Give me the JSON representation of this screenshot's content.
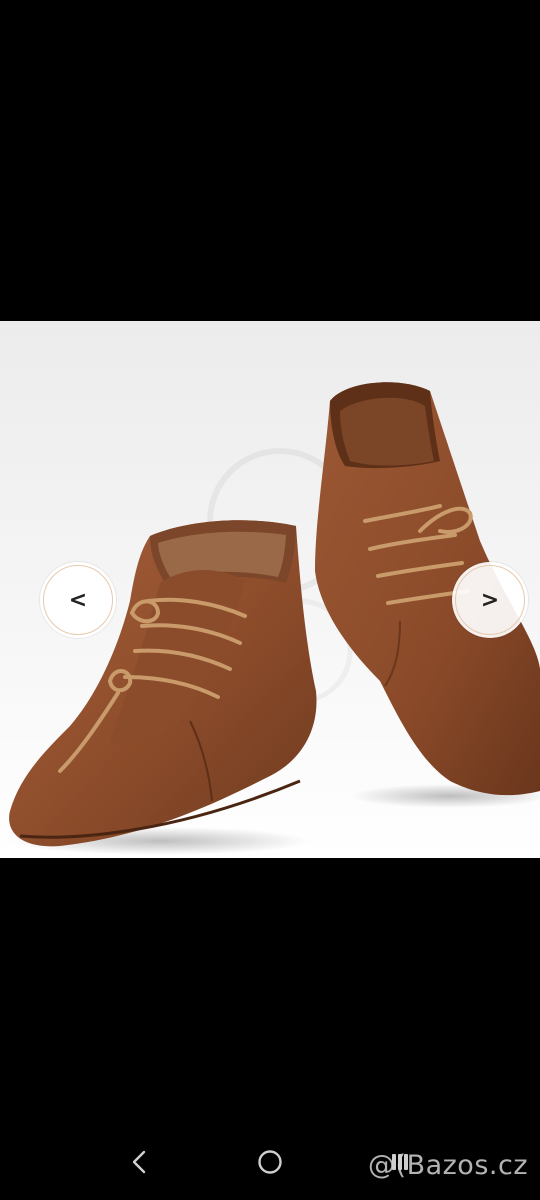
{
  "gallery": {
    "prev_label": "<",
    "next_label": ">",
    "photo_subject": "brown-leather-lace-up-boots"
  },
  "watermark": {
    "text": "@(Bazos.cz"
  },
  "system_nav": {
    "back_icon": "chevron-left-icon",
    "home_icon": "circle-home-icon",
    "recents_icon": "recents-icon"
  },
  "colors": {
    "background": "#000000",
    "leather": "#9a5532",
    "leather_dark": "#6e3a20",
    "photo_bg": "#f2f2f2"
  }
}
